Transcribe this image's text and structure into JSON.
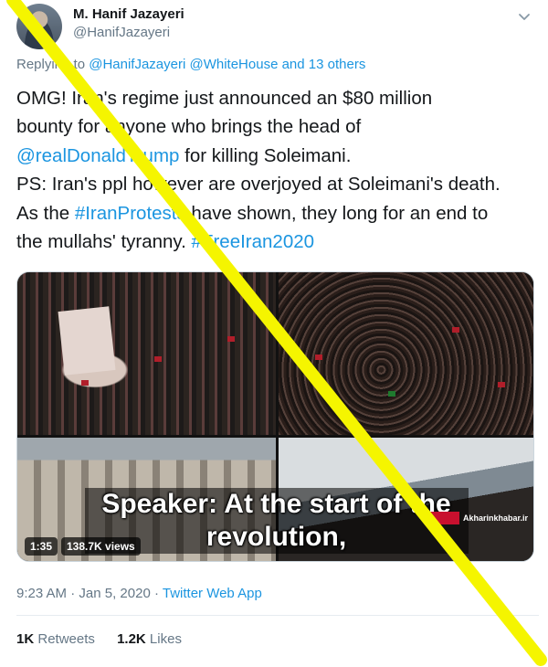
{
  "author": {
    "display_name": "M. Hanif Jazayeri",
    "handle": "@HanifJazayeri"
  },
  "reply": {
    "prefix": "Replying to",
    "mentions": "@HanifJazayeri @WhiteHouse",
    "suffix": "and 13 others"
  },
  "tweet": {
    "line1": "OMG! Iran's regime just announced an $80 million",
    "line2": "bounty for anyone who brings the head of",
    "line3_link": "@realDonaldTrump",
    "line3_rest": " for killing Soleimani.",
    "line4": "PS: Iran's ppl however are overjoyed at Soleimani's death.",
    "line5_pre": "As the ",
    "line5_link": "#IranProtests",
    "line5_post": " have shown, they long for an end to",
    "line6_pre": "the mullahs' tyranny. ",
    "line6_link": "#FreeIran2020"
  },
  "media": {
    "subtitle_line1": "Speaker: At the start of the",
    "subtitle_line2": "revolution,",
    "duration": "1:35",
    "views": "138.7K views",
    "watermark": "Akharinkhabar.ir"
  },
  "meta": {
    "time": "9:23 AM",
    "sep1": " · ",
    "date": "Jan 5, 2020",
    "sep2": " · ",
    "source": "Twitter Web App"
  },
  "stats": {
    "retweets_count": "1K",
    "retweets_label": "Retweets",
    "likes_count": "1.2K",
    "likes_label": "Likes"
  },
  "colors": {
    "link": "#1b95e0",
    "muted": "#657786",
    "overlay_slash": "#f5f500"
  },
  "icons": {
    "caret": "chevron-down-icon"
  }
}
